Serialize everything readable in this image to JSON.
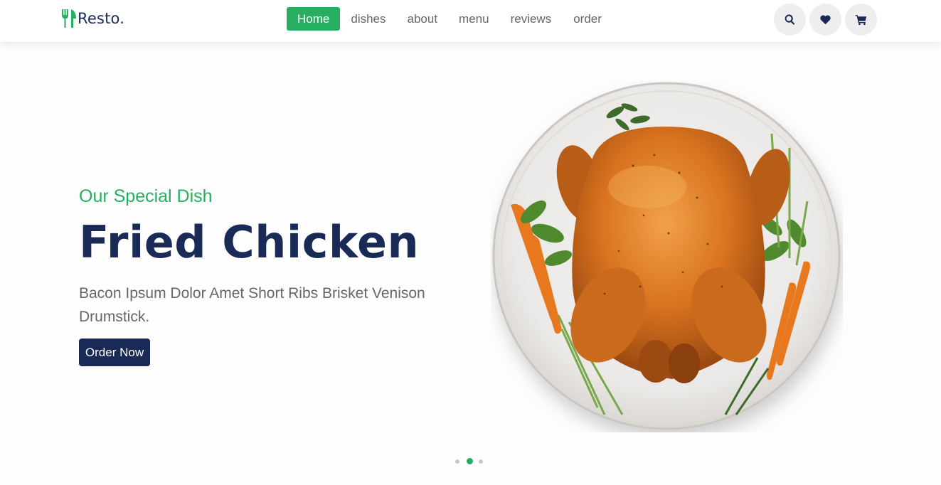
{
  "brand": {
    "name": "Resto.",
    "icon": "utensils-icon",
    "accent_color": "#27ae60",
    "dark_color": "#192a56"
  },
  "nav": {
    "items": [
      {
        "label": "Home",
        "active": true
      },
      {
        "label": "dishes",
        "active": false
      },
      {
        "label": "about",
        "active": false
      },
      {
        "label": "menu",
        "active": false
      },
      {
        "label": "reviews",
        "active": false
      },
      {
        "label": "order",
        "active": false
      }
    ]
  },
  "header_icons": [
    "search-icon",
    "heart-icon",
    "cart-icon"
  ],
  "hero": {
    "subtitle": "Our Special Dish",
    "title": "Fried Chicken",
    "description": "Bacon Ipsum Dolor Amet Short Ribs Brisket Venison Drumstick.",
    "button_label": "Order Now",
    "image": "roast-chicken-plate"
  },
  "slider": {
    "slides": 3,
    "active_index": 1
  }
}
